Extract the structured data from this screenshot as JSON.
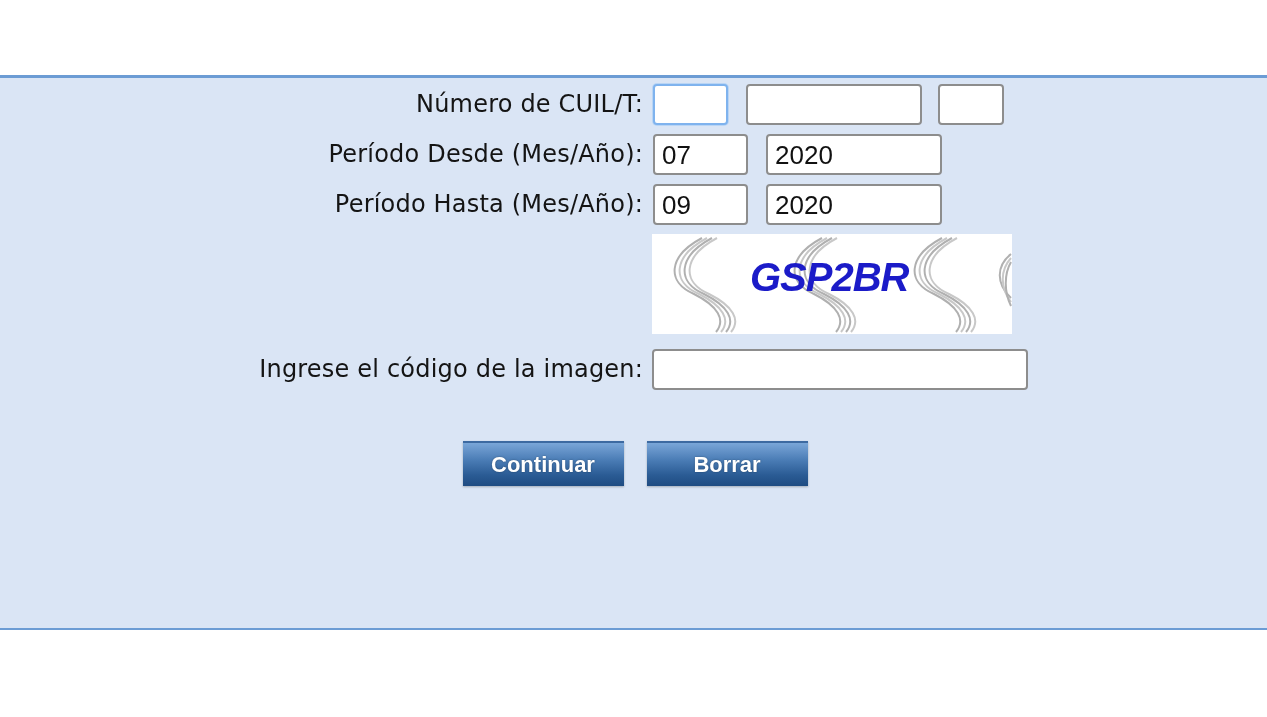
{
  "form": {
    "rows": [
      {
        "kind": "cuil",
        "label": "Número de CUIL/T:",
        "inputs": [
          {
            "focused": true
          },
          {
            "focused": false
          },
          {
            "focused": false
          }
        ]
      },
      {
        "kind": "period",
        "label": "Período Desde (Mes/Año):",
        "inputs": [
          {
            "value": "07",
            "focused": false
          },
          {
            "value": "2020",
            "focused": false
          }
        ]
      },
      {
        "kind": "period",
        "label": "Período Hasta (Mes/Año):",
        "inputs": [
          {
            "value": "09",
            "focused": false
          },
          {
            "value": "2020",
            "focused": false
          }
        ]
      },
      {
        "kind": "captcha",
        "code": "GSP2BR"
      },
      {
        "kind": "code",
        "label": "Ingrese el código de la imagen:",
        "inputs": [
          {
            "focused": false
          }
        ]
      }
    ],
    "buttons": [
      {
        "label": "Continuar"
      },
      {
        "label": "Borrar"
      }
    ]
  }
}
